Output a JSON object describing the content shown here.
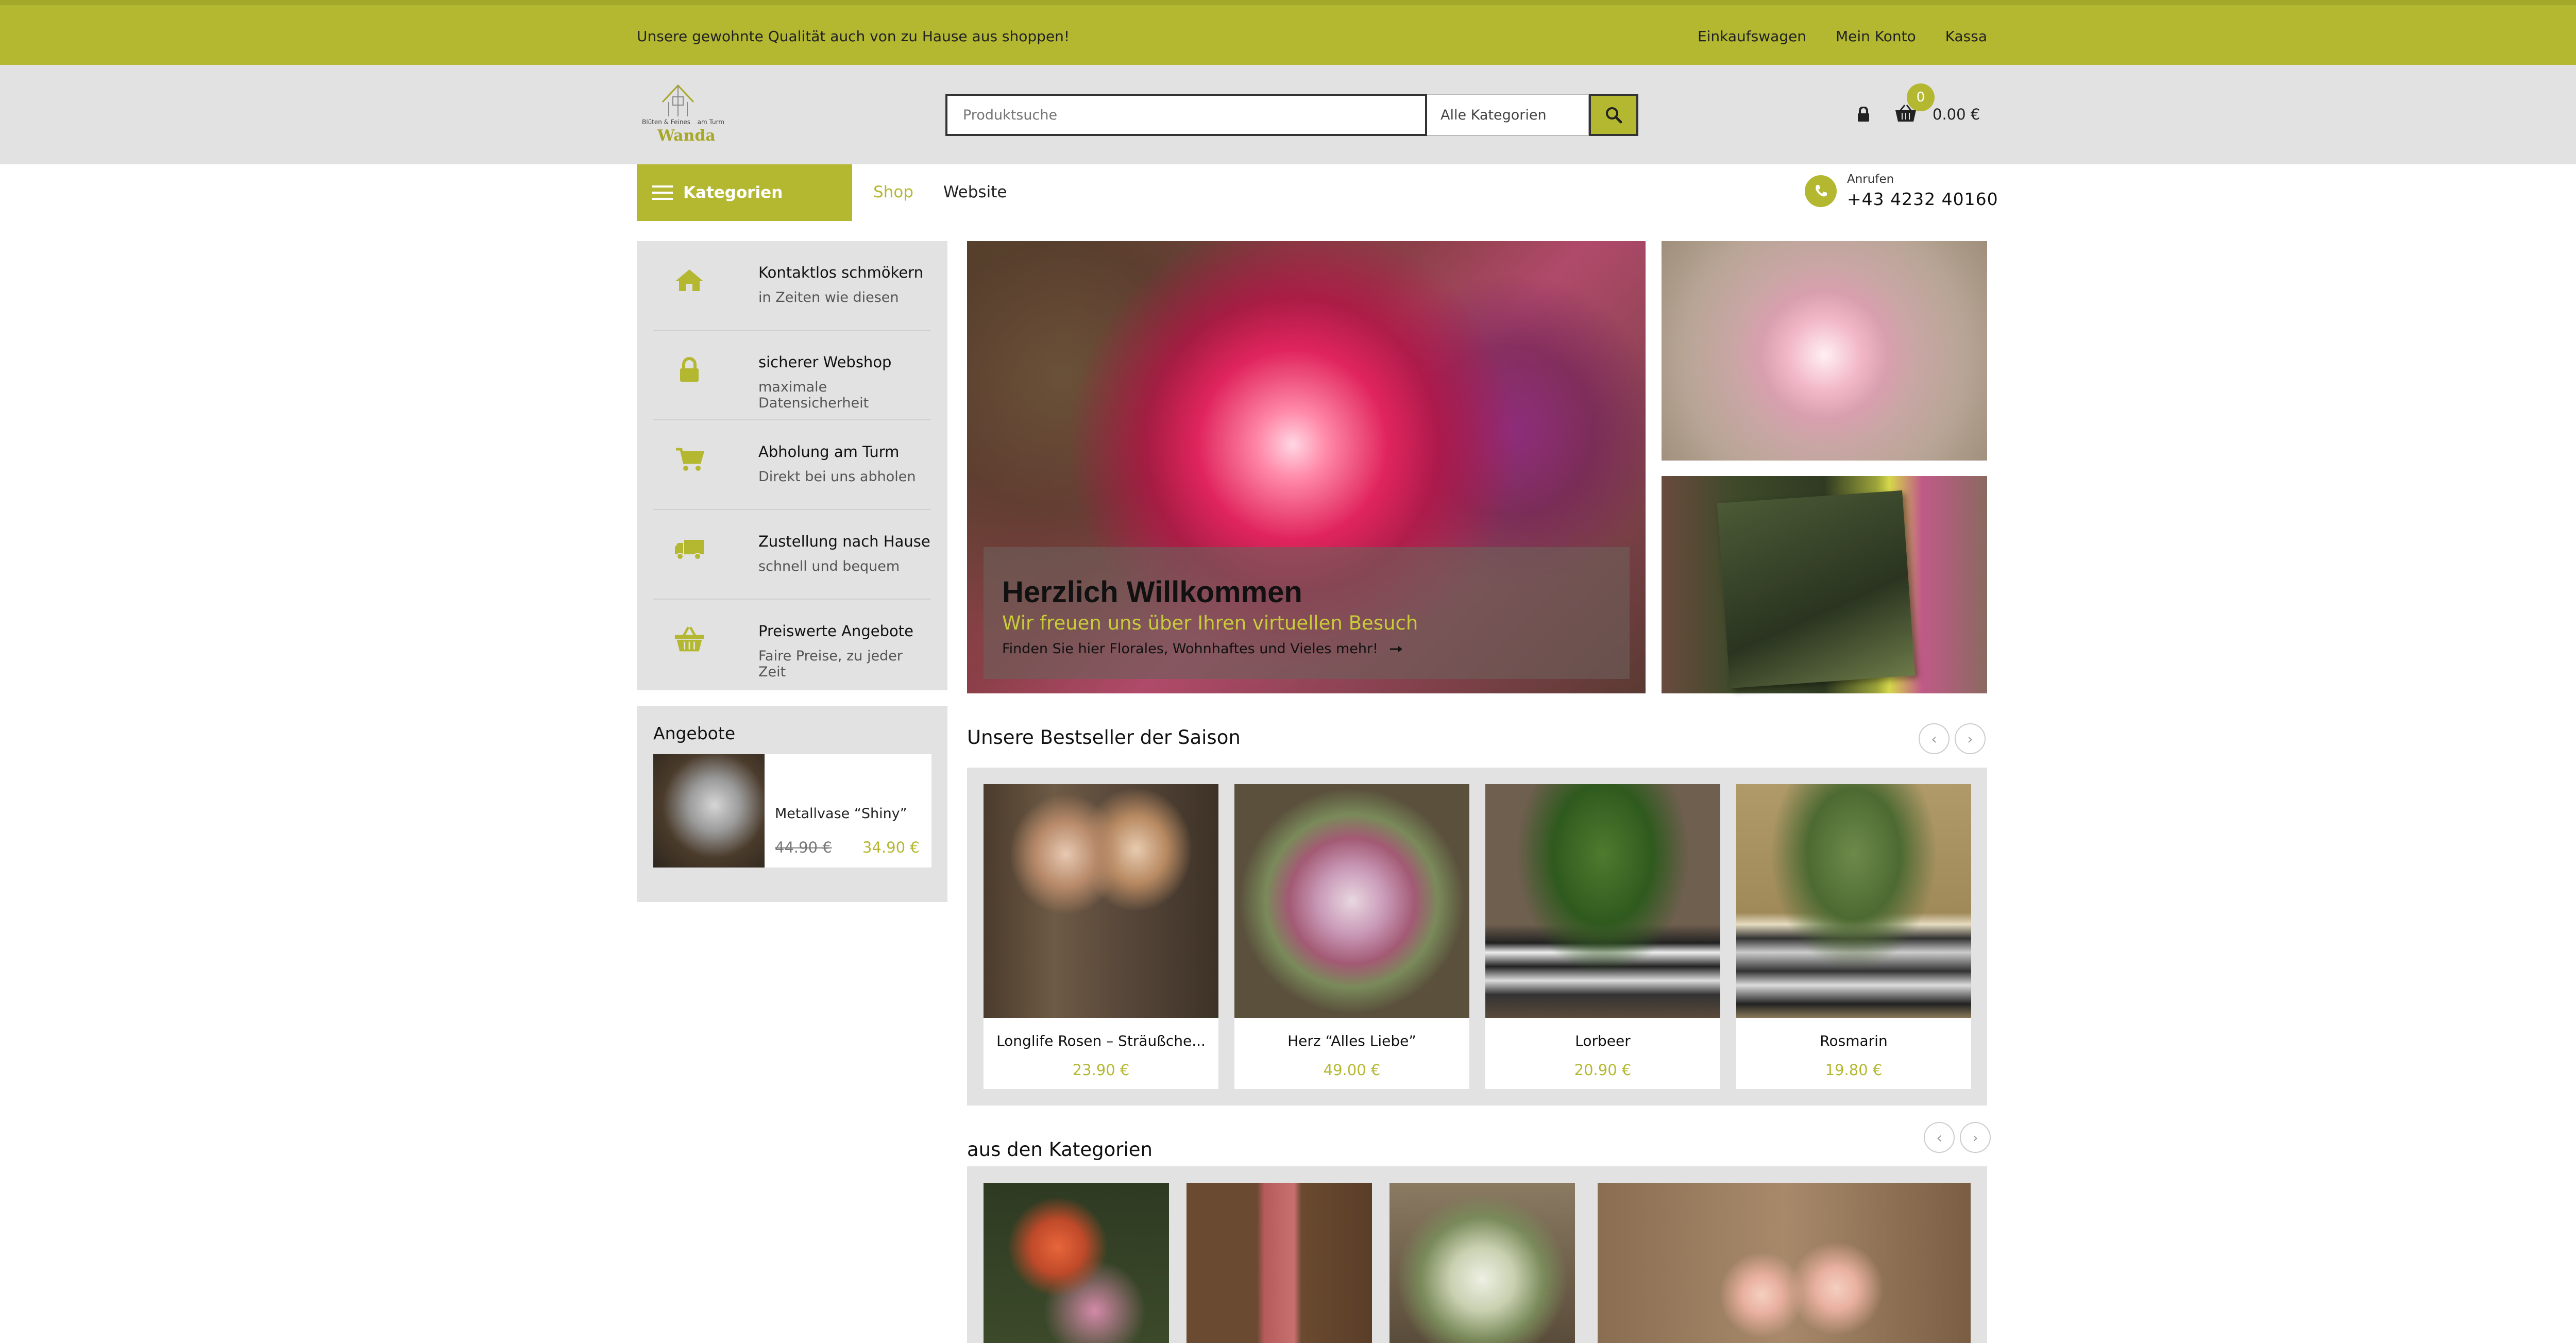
{
  "topbar": {
    "promo": "Unsere gewohnte Qualität auch von zu Hause aus shoppen!",
    "links": [
      "Einkaufswagen",
      "Mein Konto",
      "Kassa"
    ]
  },
  "header": {
    "logo_tiny_left": "Blüten & Feines",
    "logo_tiny_right": "am Turm",
    "logo_word": "Wanda",
    "search_placeholder": "Produktsuche",
    "category_select": "Alle Kategorien",
    "cart_count": "0",
    "cart_total": "0.00 €"
  },
  "nav": {
    "categories_label": "Kategorien",
    "links": [
      "Shop",
      "Website"
    ],
    "phone_label": "Anrufen",
    "phone_number": "+43 4232 40160"
  },
  "features": [
    {
      "icon": "home-icon",
      "title": "Kontaktlos schmökern",
      "sub": "in Zeiten wie diesen"
    },
    {
      "icon": "lock-icon",
      "title": "sicherer Webshop",
      "sub": "maximale Datensicherheit"
    },
    {
      "icon": "cart-icon",
      "title": "Abholung am Turm",
      "sub": "Direkt bei uns abholen"
    },
    {
      "icon": "truck-icon",
      "title": "Zustellung nach Hause",
      "sub": "schnell und bequem"
    },
    {
      "icon": "basket-icon",
      "title": "Preiswerte Angebote",
      "sub": "Faire Preise, zu jeder Zeit"
    }
  ],
  "offers": {
    "title": "Angebote",
    "item": {
      "name": "Metallvase “Shiny”",
      "old_price": "44.90 €",
      "new_price": "34.90 €"
    }
  },
  "hero": {
    "heading": "Herzlich Willkommen",
    "subheading": "Wir freuen uns über Ihren virtuellen Besuch",
    "text": "Finden Sie hier Florales, Wohnhaftes und Vieles mehr!"
  },
  "bestseller": {
    "title": "Unsere Bestseller der Saison",
    "products": [
      {
        "name": "Longlife Rosen – Sträußche...",
        "price": "23.90 €"
      },
      {
        "name": "Herz “Alles Liebe”",
        "price": "49.00 €"
      },
      {
        "name": "Lorbeer",
        "price": "20.90 €"
      },
      {
        "name": "Rosmarin",
        "price": "19.80 €"
      }
    ]
  },
  "categories_section": {
    "title": "aus den Kategorien"
  },
  "colors": {
    "accent": "#b4b831",
    "panel": "#e2e2e2"
  }
}
